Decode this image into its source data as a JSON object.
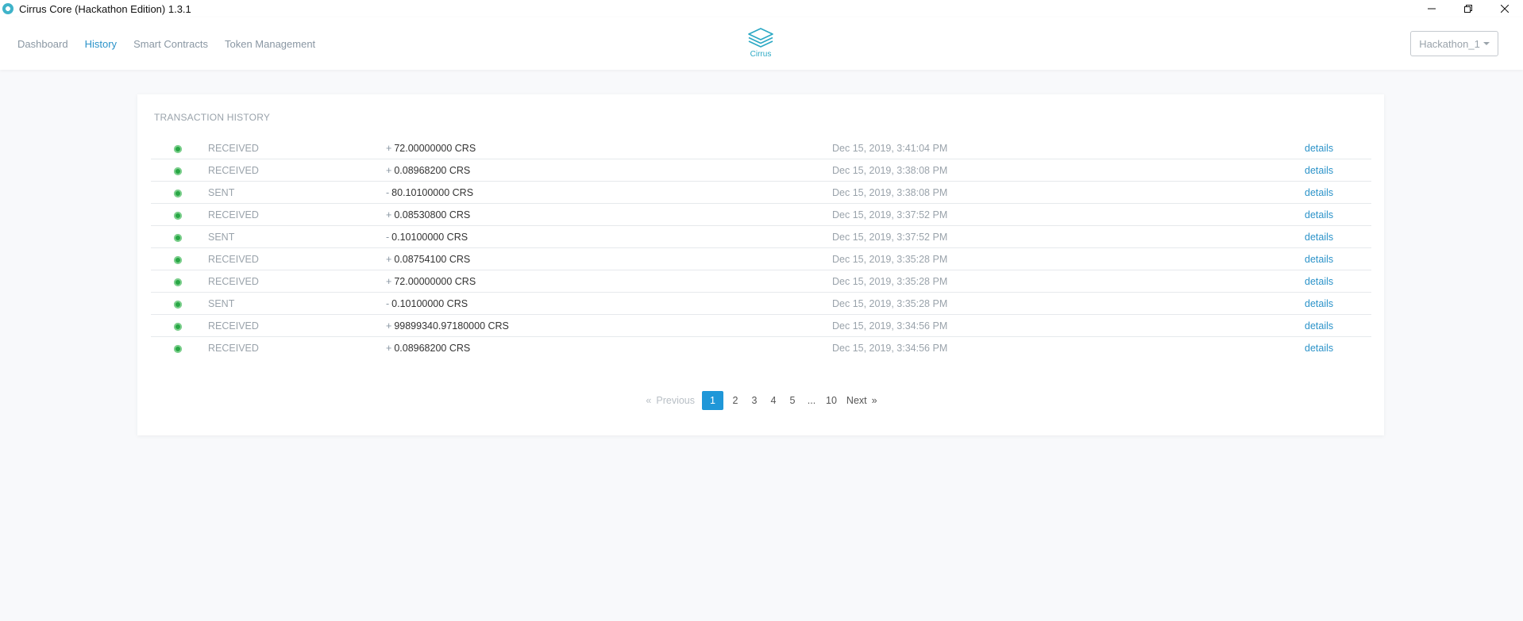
{
  "window": {
    "title": "Cirrus Core (Hackathon Edition) 1.3.1"
  },
  "nav": {
    "links": [
      {
        "label": "Dashboard",
        "active": false
      },
      {
        "label": "History",
        "active": true
      },
      {
        "label": "Smart Contracts",
        "active": false
      },
      {
        "label": "Token Management",
        "active": false
      }
    ],
    "logo_label": "Cirrus",
    "account": "Hackathon_1"
  },
  "history": {
    "title": "TRANSACTION HISTORY",
    "details_label": "details",
    "transactions": [
      {
        "type": "RECEIVED",
        "sign": "+",
        "amount": "72.00000000 CRS",
        "date": "Dec 15, 2019, 3:41:04 PM"
      },
      {
        "type": "RECEIVED",
        "sign": "+",
        "amount": "0.08968200 CRS",
        "date": "Dec 15, 2019, 3:38:08 PM"
      },
      {
        "type": "SENT",
        "sign": "-",
        "amount": "80.10100000 CRS",
        "date": "Dec 15, 2019, 3:38:08 PM"
      },
      {
        "type": "RECEIVED",
        "sign": "+",
        "amount": "0.08530800 CRS",
        "date": "Dec 15, 2019, 3:37:52 PM"
      },
      {
        "type": "SENT",
        "sign": "-",
        "amount": "0.10100000 CRS",
        "date": "Dec 15, 2019, 3:37:52 PM"
      },
      {
        "type": "RECEIVED",
        "sign": "+",
        "amount": "0.08754100 CRS",
        "date": "Dec 15, 2019, 3:35:28 PM"
      },
      {
        "type": "RECEIVED",
        "sign": "+",
        "amount": "72.00000000 CRS",
        "date": "Dec 15, 2019, 3:35:28 PM"
      },
      {
        "type": "SENT",
        "sign": "-",
        "amount": "0.10100000 CRS",
        "date": "Dec 15, 2019, 3:35:28 PM"
      },
      {
        "type": "RECEIVED",
        "sign": "+",
        "amount": "99899340.97180000 CRS",
        "date": "Dec 15, 2019, 3:34:56 PM"
      },
      {
        "type": "RECEIVED",
        "sign": "+",
        "amount": "0.08968200 CRS",
        "date": "Dec 15, 2019, 3:34:56 PM"
      }
    ]
  },
  "pagination": {
    "prev_arrow": "«",
    "previous": "Previous",
    "pages": [
      "1",
      "2",
      "3",
      "4",
      "5",
      "...",
      "10"
    ],
    "current": "1",
    "next": "Next",
    "next_arrow": "»"
  },
  "colors": {
    "accent": "#2c93c9",
    "status_ok": "#28a745",
    "page_current": "#1f97d8"
  },
  "icons": {
    "app": "cirrus-app-icon",
    "logo": "cirrus-layers-logo",
    "status": "status-confirmed-icon"
  }
}
